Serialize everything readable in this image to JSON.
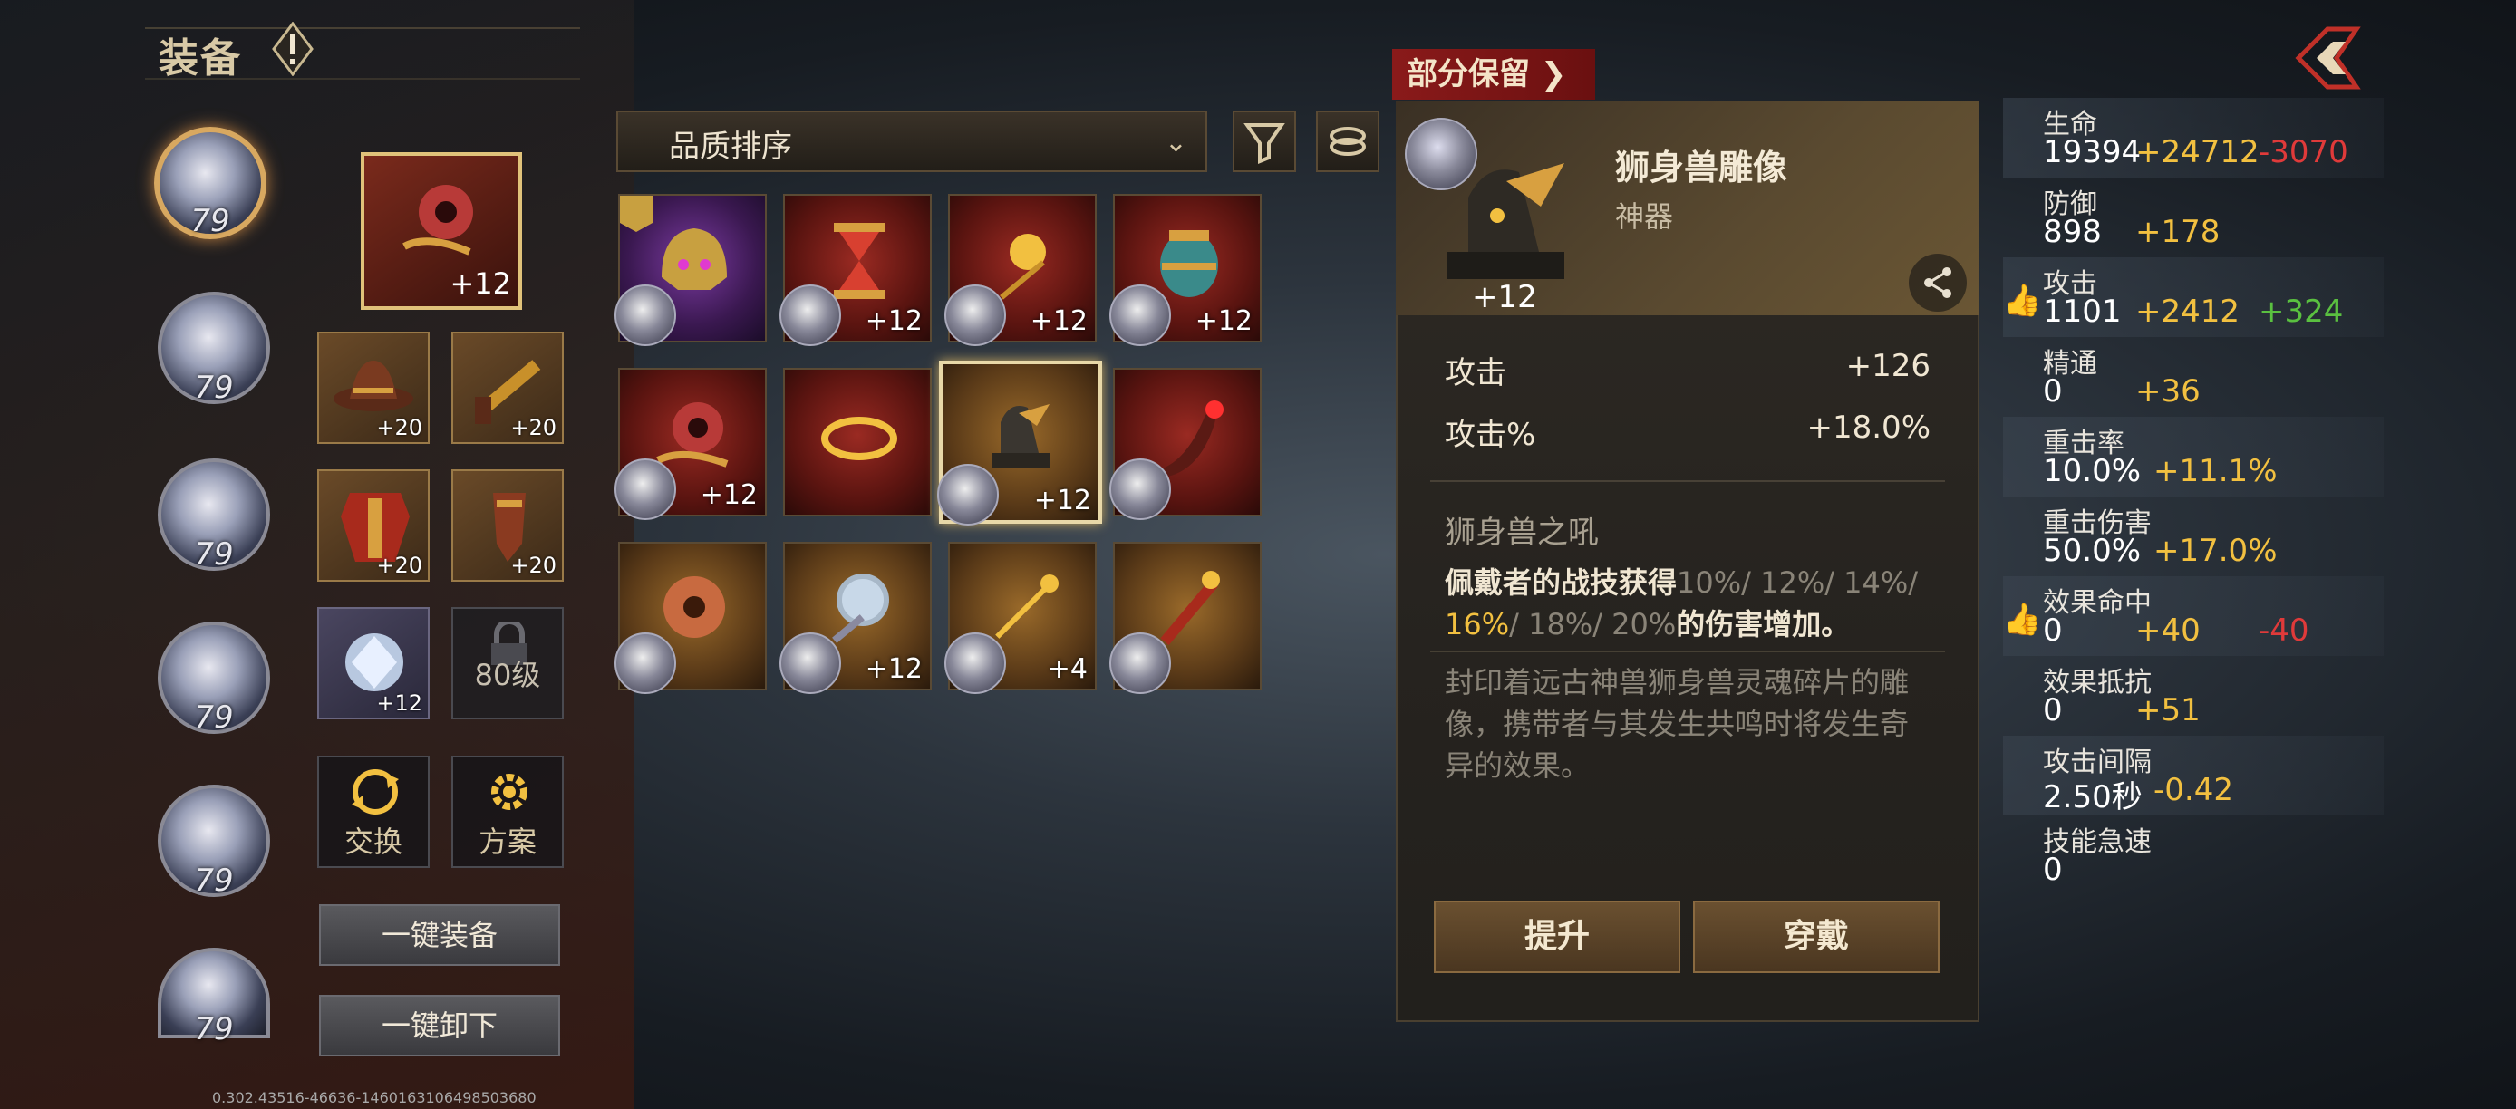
{
  "header": {
    "title": "装备"
  },
  "avatars": [
    {
      "level": "79"
    },
    {
      "level": "79"
    },
    {
      "level": "79"
    },
    {
      "level": "79"
    },
    {
      "level": "79"
    },
    {
      "level": "79"
    }
  ],
  "equipped": {
    "artifact_plus": "+12",
    "slots": [
      {
        "plus": "+20"
      },
      {
        "plus": "+20"
      },
      {
        "plus": "+20"
      },
      {
        "plus": "+20"
      },
      {
        "plus": "+12"
      }
    ],
    "locked_slot": "80级",
    "swap_label": "交换",
    "plan_label": "方案",
    "equip_all": "一键装备",
    "unequip_all": "一键卸下"
  },
  "sort": {
    "label": "品质排序"
  },
  "inventory": [
    {
      "plus": ""
    },
    {
      "plus": "+12"
    },
    {
      "plus": "+12"
    },
    {
      "plus": "+12"
    },
    {
      "plus": "+12"
    },
    {
      "plus": ""
    },
    {
      "plus": "+12"
    },
    {
      "plus": ""
    },
    {
      "plus": ""
    },
    {
      "plus": "+12"
    },
    {
      "plus": "+4"
    },
    {
      "plus": ""
    }
  ],
  "detail": {
    "ribbon": "部分保留",
    "name": "狮身兽雕像",
    "type": "神器",
    "plus": "+12",
    "stats": [
      {
        "label": "攻击",
        "value": "+126"
      },
      {
        "label": "攻击%",
        "value": "+18.0%"
      }
    ],
    "passive_title": "狮身兽之吼",
    "passive_prefix": "佩戴者的战技获得",
    "passive_values": [
      "10%",
      "12%",
      "14%",
      "16%",
      "18%",
      "20%"
    ],
    "passive_suffix": "的伤害增加。",
    "lore": "封印着远古神兽狮身兽灵魂碎片的雕像，携带者与其发生共鸣时将发生奇异的效果。",
    "upgrade_label": "提升",
    "wear_label": "穿戴"
  },
  "char_stats": [
    {
      "label": "生命",
      "base": "19394",
      "bonus": "+24712",
      "delta": "-3070",
      "delta_color": "#e03a3a",
      "thumb": false
    },
    {
      "label": "防御",
      "base": "898",
      "bonus": "+178",
      "delta": "",
      "delta_color": "",
      "thumb": false
    },
    {
      "label": "攻击",
      "base": "1101",
      "bonus": "+2412",
      "delta": "+324",
      "delta_color": "#5ac040",
      "thumb": true
    },
    {
      "label": "精通",
      "base": "0",
      "bonus": "+36",
      "delta": "",
      "delta_color": "",
      "thumb": false
    },
    {
      "label": "重击率",
      "base": "10.0%",
      "bonus": "+11.1%",
      "delta": "",
      "delta_color": "",
      "thumb": false
    },
    {
      "label": "重击伤害",
      "base": "50.0%",
      "bonus": "+17.0%",
      "delta": "",
      "delta_color": "",
      "thumb": false
    },
    {
      "label": "效果命中",
      "base": "0",
      "bonus": "+40",
      "delta": "-40",
      "delta_color": "#e03a3a",
      "thumb": true
    },
    {
      "label": "效果抵抗",
      "base": "0",
      "bonus": "+51",
      "delta": "",
      "delta_color": "",
      "thumb": false
    },
    {
      "label": "攻击间隔",
      "base": "2.50秒",
      "bonus": "-0.42",
      "delta": "",
      "delta_color": "",
      "thumb": false
    },
    {
      "label": "技能急速",
      "base": "0",
      "bonus": "",
      "delta": "",
      "delta_color": "",
      "thumb": false
    }
  ],
  "version": "0.302.43516-46636-1460163106498503680"
}
